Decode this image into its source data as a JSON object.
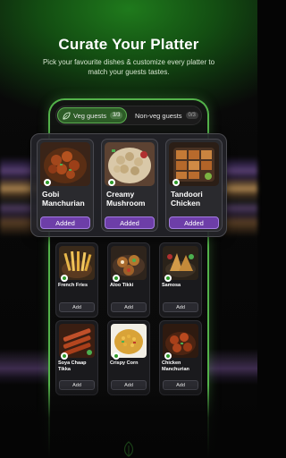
{
  "colors": {
    "accent_green": "#53b24a",
    "added_purple": "#6d3ea8",
    "veg_dot": "#2f9a2a"
  },
  "header": {
    "title": "Curate Your Platter",
    "subtitle": "Pick your favourite dishes & customize every platter to match your guests tastes."
  },
  "toggle": {
    "veg": {
      "label": "Veg guests",
      "count": "3/3",
      "icon": "leaf-icon"
    },
    "nonveg": {
      "label": "Non-veg guests",
      "count": "0/3"
    }
  },
  "featured": [
    {
      "name": "Gobi Manchurian",
      "button": "Added"
    },
    {
      "name": "Creamy Mushroom",
      "button": "Added"
    },
    {
      "name": "Tandoori Chicken",
      "button": "Added"
    }
  ],
  "dishes": [
    {
      "name": "French Fries",
      "button": "Add"
    },
    {
      "name": "Aloo Tikki",
      "button": "Add"
    },
    {
      "name": "Samosa",
      "button": "Add"
    },
    {
      "name": "Soya Chaap Tikka",
      "button": "Add"
    },
    {
      "name": "Crispy Corn",
      "button": "Add"
    },
    {
      "name": "Chicken Manchurian",
      "button": "Add"
    }
  ]
}
